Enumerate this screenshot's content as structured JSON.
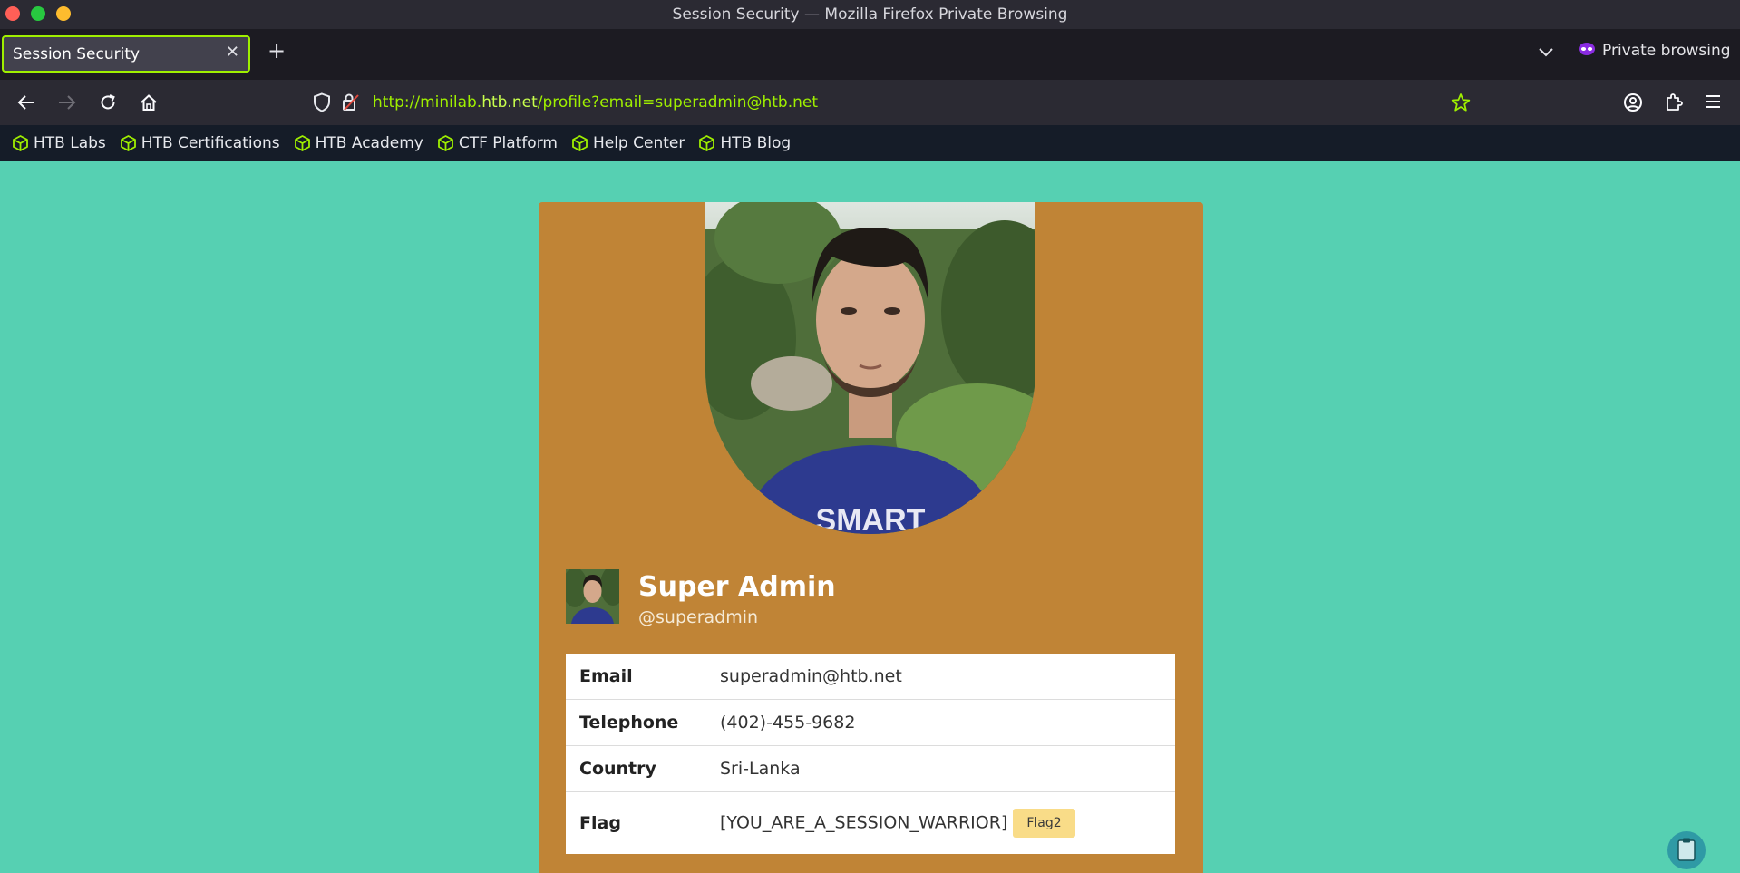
{
  "window": {
    "title": "Session Security — Mozilla Firefox Private Browsing"
  },
  "tabs": [
    {
      "label": "Session Security"
    }
  ],
  "private_label": "Private browsing",
  "url": {
    "prefix": "http://minilab.",
    "domain": "htb.net",
    "path": "/profile?email=superadmin@htb.net"
  },
  "bookmarks": [
    "HTB Labs",
    "HTB Certifications",
    "HTB Academy",
    "CTF Platform",
    "Help Center",
    "HTB Blog"
  ],
  "profile": {
    "name": "Super Admin",
    "handle": "@superadmin",
    "rows": [
      {
        "label": "Email",
        "value": "superadmin@htb.net"
      },
      {
        "label": "Telephone",
        "value": "(402)-455-9682"
      },
      {
        "label": "Country",
        "value": "Sri-Lanka"
      },
      {
        "label": "Flag",
        "value": "[YOU_ARE_A_SESSION_WARRIOR]"
      }
    ],
    "flag_button": "Flag2",
    "shirt_text": "SMART"
  },
  "colors": {
    "accent": "#9fef00",
    "page_bg": "#56d0b2",
    "card_bg": "#c08436",
    "flag_button_bg": "#f9dc88"
  },
  "icons": [
    "back-icon",
    "forward-icon",
    "reload-icon",
    "home-icon",
    "shield-icon",
    "lock-warning-icon",
    "bookmark-star-icon",
    "account-icon",
    "extensions-icon",
    "menu-icon",
    "bookmark-cube-icon",
    "private-mask-icon",
    "clipboard-icon"
  ]
}
